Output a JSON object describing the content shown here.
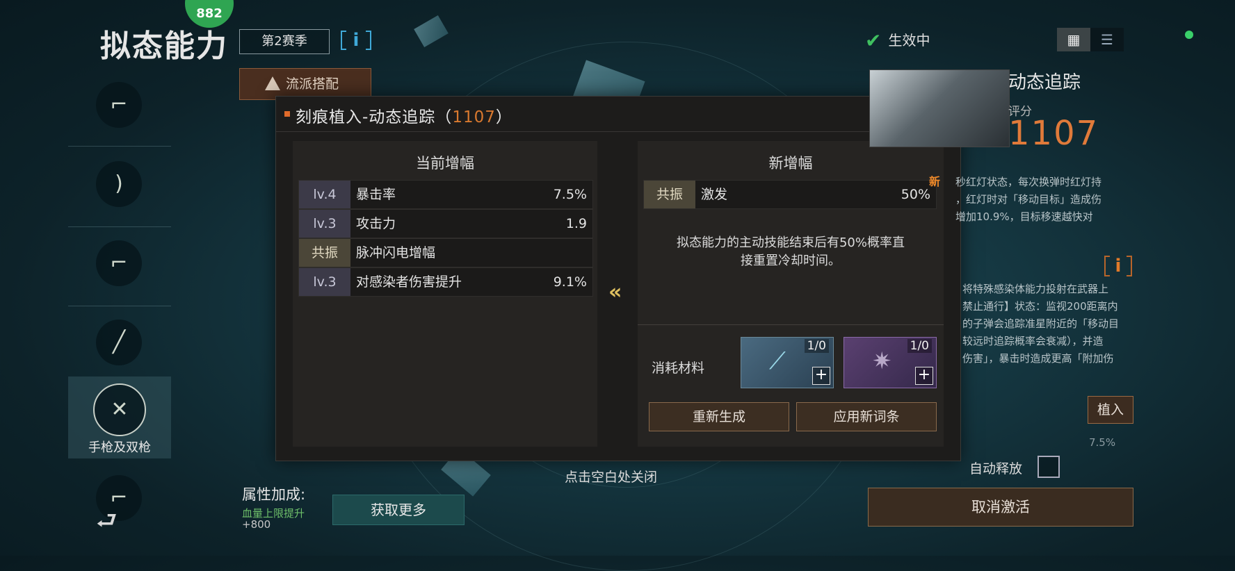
{
  "header": {
    "title": "拟态能力",
    "season": "第2赛季",
    "badge_text": "882",
    "school_button": "流派搭配",
    "info_glyph": "i"
  },
  "sidebar": {
    "items": [
      {
        "icon": "assault-rifle-icon",
        "glyph": "⌐",
        "label": ""
      },
      {
        "icon": "bow-icon",
        "glyph": ")",
        "label": ""
      },
      {
        "icon": "shotgun-icon",
        "glyph": "⌐",
        "label": ""
      },
      {
        "icon": "sniper-rifle-icon",
        "glyph": "╱",
        "label": ""
      },
      {
        "icon": "dual-pistol-icon",
        "glyph": "✕",
        "label": "手枪及双枪",
        "active": true
      },
      {
        "icon": "smg-icon",
        "glyph": "⌐",
        "label": ""
      }
    ],
    "back_glyph": "⮐"
  },
  "dialog": {
    "title_prefix": "刻痕植入-动态追踪（",
    "title_score": "1107",
    "title_suffix": "）",
    "current": {
      "heading": "当前增幅",
      "rows": [
        {
          "tag": "lv.4",
          "name": "暴击率",
          "value": "7.5%"
        },
        {
          "tag": "lv.3",
          "name": "攻击力",
          "value": "1.9"
        },
        {
          "tag": "共振",
          "name": "脉冲闪电增幅",
          "value": ""
        },
        {
          "tag": "lv.3",
          "name": "对感染者伤害提升",
          "value": "9.1%"
        }
      ]
    },
    "new": {
      "heading": "新增幅",
      "row": {
        "tag": "共振",
        "name": "激发",
        "value": "50%",
        "badge": "新"
      },
      "description_line1": "拟态能力的主动技能结束后有50%概率直",
      "description_line2": "接重置冷却时间。",
      "materials_label": "消耗材料",
      "materials": [
        {
          "count": "1/0",
          "icon": "syringe-icon",
          "glyph": "⟋"
        },
        {
          "count": "1/0",
          "icon": "tentacle-core-icon",
          "glyph": "✷"
        }
      ],
      "regen_button": "重新生成",
      "apply_button": "应用新词条"
    },
    "arrow": "«",
    "close_hint": "点击空白处关闭"
  },
  "right_panel": {
    "status": "生效中",
    "module_name": "动态追踪",
    "score_label": "评分",
    "score": "1107",
    "desc_lines": [
      "秒红灯状态，每次换弹时红灯持",
      "，红灯时对「移动目标」造成伤",
      "增加10.9%，目标移速越快对"
    ],
    "desc2_lines": [
      "将特殊感染体能力投射在武器上",
      "禁止通行】状态：监视200距离内",
      "的子弹会追踪准星附近的「移动目",
      "较远时追踪概率会衰减），并造",
      "伤害」，暴击时造成更高「附加伤"
    ],
    "implant_button": "植入",
    "percent": "7.5%",
    "auto_release": "自动释放",
    "cancel_button": "取消激活"
  },
  "bottom": {
    "attr_label": "属性加成:",
    "attr_line1": "血量上限提升",
    "attr_line2": "+800",
    "get_more": "获取更多"
  },
  "colors": {
    "accent_orange": "#e07a3a",
    "status_green": "#3fc060",
    "info_blue": "#3fa9d8"
  }
}
